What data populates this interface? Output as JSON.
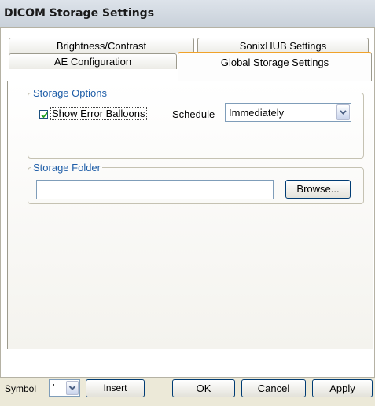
{
  "window": {
    "title": "DICOM Storage Settings"
  },
  "tabs": {
    "row1": [
      {
        "label": "Brightness/Contrast"
      },
      {
        "label": "SonixHUB Settings"
      }
    ],
    "row2": [
      {
        "label": "AE Configuration"
      },
      {
        "label": "Global Storage Settings",
        "active": true
      }
    ]
  },
  "storage_options": {
    "legend": "Storage Options",
    "show_error_balloons": {
      "label": "Show Error Balloons",
      "checked": true
    },
    "schedule": {
      "label": "Schedule",
      "value": "Immediately"
    }
  },
  "storage_folder": {
    "legend": "Storage Folder",
    "path": "",
    "browse_label": "Browse..."
  },
  "bottom": {
    "symbol_label": "Symbol",
    "symbol_value": "'",
    "insert_label": "Insert",
    "ok_label": "OK",
    "cancel_label": "Cancel",
    "apply_label": "Apply"
  },
  "colors": {
    "accent_tab": "#f0a22a",
    "legend_text": "#1f5ea8",
    "button_border": "#003c74"
  }
}
